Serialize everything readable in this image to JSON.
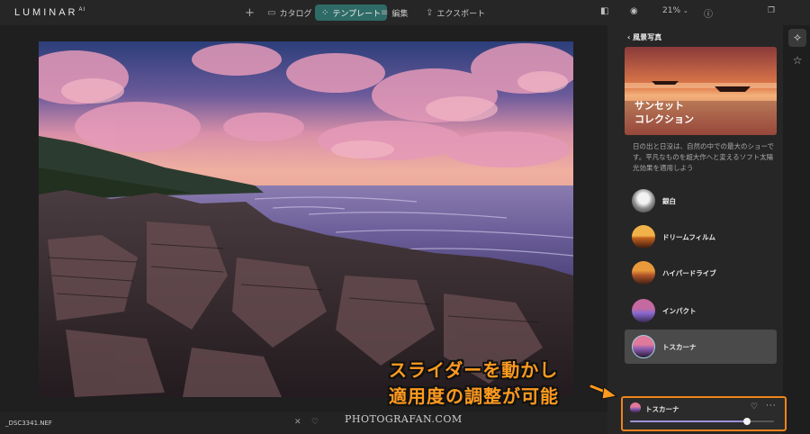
{
  "app": {
    "logo": "LUMINAR",
    "logo_suffix": "AI"
  },
  "topbar": {
    "add_label": "+",
    "tabs": [
      {
        "label": "カタログ",
        "icon": "folder-icon"
      },
      {
        "label": "テンプレート",
        "icon": "sparkle-icon",
        "active": true
      },
      {
        "label": "編集",
        "icon": "sliders-icon"
      },
      {
        "label": "エクスポート",
        "icon": "export-icon"
      }
    ],
    "zoom": "21%",
    "icons": [
      "compare-icon",
      "eye-icon",
      "info-icon",
      "window-icon"
    ]
  },
  "bottombar": {
    "filename": "_DSC3341.NEF",
    "reject": "✕",
    "favorite": "♡"
  },
  "watermark": "PHOTOGRAFAN.COM",
  "panel": {
    "back_label": "風景写真",
    "hero_title": "サンセット\nコレクション",
    "description": "日の出と日没は、自然の中での最大のショーです。平凡なものを超大作へと変えるソフト太陽光効果を適用しよう",
    "presets": [
      {
        "label": "銀白",
        "thumb": "bw"
      },
      {
        "label": "ドリームフィルム",
        "thumb": "gold"
      },
      {
        "label": "ハイパードライブ",
        "thumb": "amber"
      },
      {
        "label": "インパクト",
        "thumb": "violet"
      },
      {
        "label": "トスカーナ",
        "thumb": "tuscany",
        "selected": true
      }
    ]
  },
  "rail": {
    "icons": [
      "magic-wand-icon",
      "star-icon"
    ]
  },
  "annotation": {
    "line1": "スライダーを動かし",
    "line2": "適用度の調整が可能"
  },
  "applied": {
    "label": "トスカーナ",
    "amount": 0.81
  },
  "colors": {
    "accent": "#2f6b66",
    "highlight": "#f0841a",
    "slider": "#9b93d8"
  }
}
